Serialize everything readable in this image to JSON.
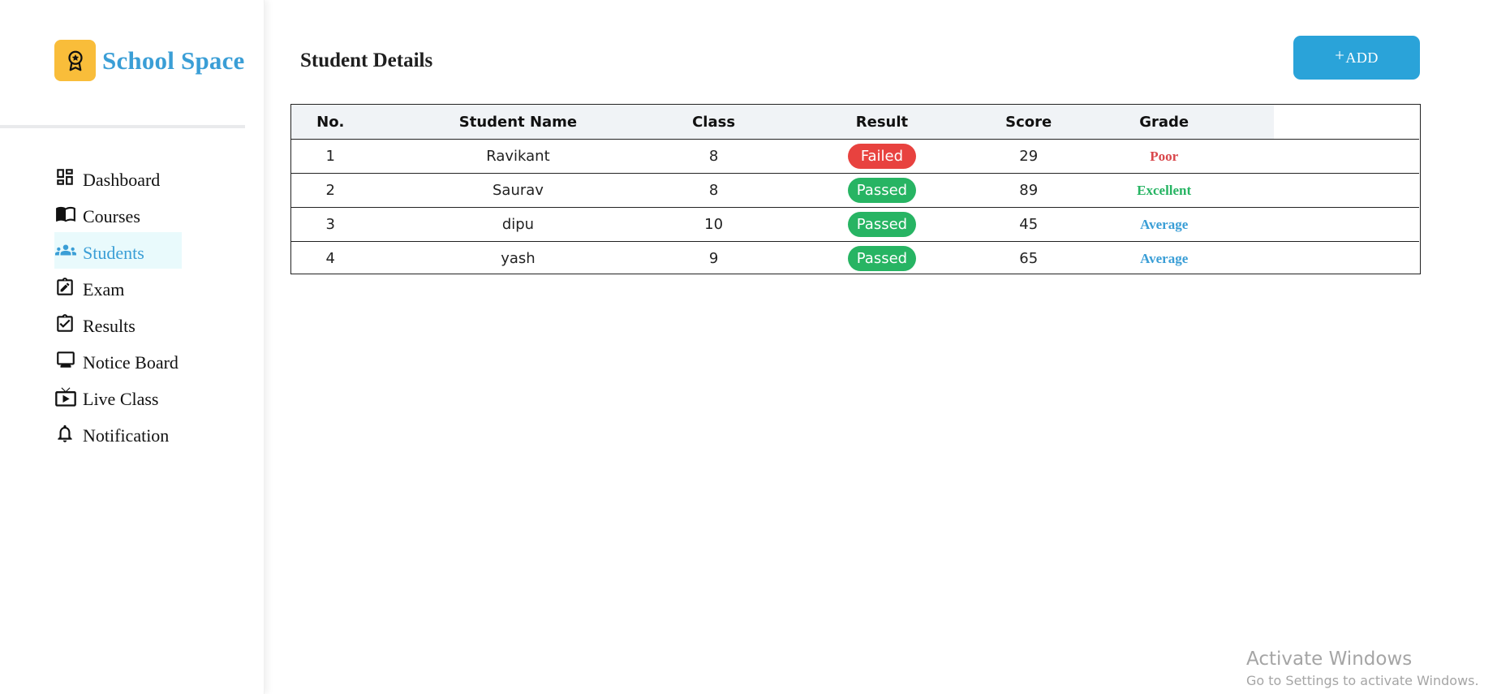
{
  "brand": {
    "name": "School Space",
    "logo_icon": "award-icon",
    "logo_color": "#f9bd3a",
    "name_color": "#3a9ed6"
  },
  "sidebar": {
    "items": [
      {
        "label": "Dashboard",
        "icon": "dashboard-icon",
        "active": false
      },
      {
        "label": "Courses",
        "icon": "book-icon",
        "active": false
      },
      {
        "label": "Students",
        "icon": "people-icon",
        "active": true
      },
      {
        "label": "Exam",
        "icon": "edit-note-icon",
        "active": false
      },
      {
        "label": "Results",
        "icon": "clipboard-check-icon",
        "active": false
      },
      {
        "label": "Notice Board",
        "icon": "monitor-icon",
        "active": false
      },
      {
        "label": "Live Class",
        "icon": "live-tv-icon",
        "active": false
      },
      {
        "label": "Notification",
        "icon": "bell-icon",
        "active": false
      }
    ]
  },
  "main": {
    "title": "Student Details",
    "add_button": {
      "plus": "+",
      "label": "ADD",
      "color": "#2aa3d9"
    }
  },
  "table": {
    "headers": [
      "No.",
      "Student Name",
      "Class",
      "Result",
      "Score",
      "Grade"
    ],
    "rows": [
      {
        "no": "1",
        "name": "Ravikant",
        "class": "8",
        "result": "Failed",
        "score": "29",
        "grade": "Poor"
      },
      {
        "no": "2",
        "name": "Saurav",
        "class": "8",
        "result": "Passed",
        "score": "89",
        "grade": "Excellent"
      },
      {
        "no": "3",
        "name": "dipu",
        "class": "10",
        "result": "Passed",
        "score": "45",
        "grade": "Average"
      },
      {
        "no": "4",
        "name": "yash",
        "class": "9",
        "result": "Passed",
        "score": "65",
        "grade": "Average"
      }
    ]
  },
  "colors": {
    "failed": "#e8423f",
    "passed": "#27b463",
    "grade_poor": "#d9474b",
    "grade_excellent": "#27b463",
    "grade_average": "#3a9ed6"
  },
  "watermark": {
    "title": "Activate Windows",
    "subtitle": "Go to Settings to activate Windows."
  }
}
